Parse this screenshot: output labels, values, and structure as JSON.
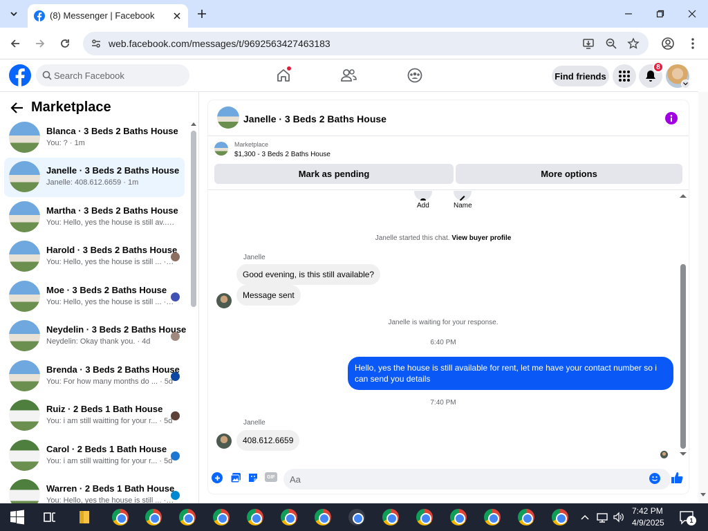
{
  "browser": {
    "tab_title": "(8) Messenger | Facebook",
    "url": "web.facebook.com/messages/t/9692563427463183"
  },
  "header": {
    "search_placeholder": "Search Facebook",
    "find_friends": "Find friends",
    "notification_count": "8"
  },
  "sidebar": {
    "title": "Marketplace",
    "conversations": [
      {
        "name": "Blanca · 3 Beds 2 Baths House",
        "preview": "You: ? · 1m",
        "active": false
      },
      {
        "name": "Janelle · 3 Beds 2 Baths House",
        "preview": "Janelle: 408.612.6659 · 1m",
        "active": true
      },
      {
        "name": "Martha · 3 Beds 2 Baths House",
        "preview": "You: Hello, yes the house is still av... · 1h",
        "active": false
      },
      {
        "name": "Harold · 3 Beds 2 Baths House",
        "preview": "You: Hello, yes the house is still ... · 3d",
        "active": false
      },
      {
        "name": "Moe · 3 Beds 2 Baths House",
        "preview": "You: Hello, yes the house is still ... · 3d",
        "active": false
      },
      {
        "name": "Neydelin · 3 Beds 2 Baths House",
        "preview": "Neydelin: Okay thank you. · 4d",
        "active": false
      },
      {
        "name": "Brenda · 3 Beds 2 Baths House",
        "preview": "You: For how many months do ... · 5d",
        "active": false
      },
      {
        "name": "Ruiz · 2 Beds 1 Bath House",
        "preview": "You: i am still waitting for your r... · 5d",
        "active": false
      },
      {
        "name": "Carol · 2 Beds 1 Bath House",
        "preview": "You: i am still waitting for your r... · 5d",
        "active": false
      },
      {
        "name": "Warren · 2 Beds 1 Bath House",
        "preview": "You: Hello, yes the house is still ... · 5d",
        "active": false
      }
    ]
  },
  "chat": {
    "title": "Janelle · 3 Beds 2 Baths House",
    "listing_label": "Marketplace",
    "listing_detail": "$1,300 - 3 Beds 2 Baths House",
    "mark_pending": "Mark as pending",
    "more_options": "More options",
    "add_label": "Add",
    "name_label": "Name",
    "started_text": "Janelle started this chat.",
    "view_profile": "View buyer profile",
    "sender_name": "Janelle",
    "msg1": "Good evening, is this still available?",
    "msg2": "Message sent",
    "waiting_text": "Janelle is waiting for your response.",
    "time1": "6:40 PM",
    "outgoing": "Hello, yes the house is still available for rent, let me have your contact number so i can send you  details",
    "time2": "7:40 PM",
    "sender_name2": "Janelle",
    "msg3": "408.612.6659",
    "composer_placeholder": "Aa"
  },
  "taskbar": {
    "time": "7:42 PM",
    "date": "4/9/2025",
    "notif_count": "1"
  },
  "colors": {
    "accent": "#0866ff",
    "outgoing_bubble": "#0a59f6",
    "active_row": "#ebf5ff",
    "info_icon": "#a100e0"
  }
}
